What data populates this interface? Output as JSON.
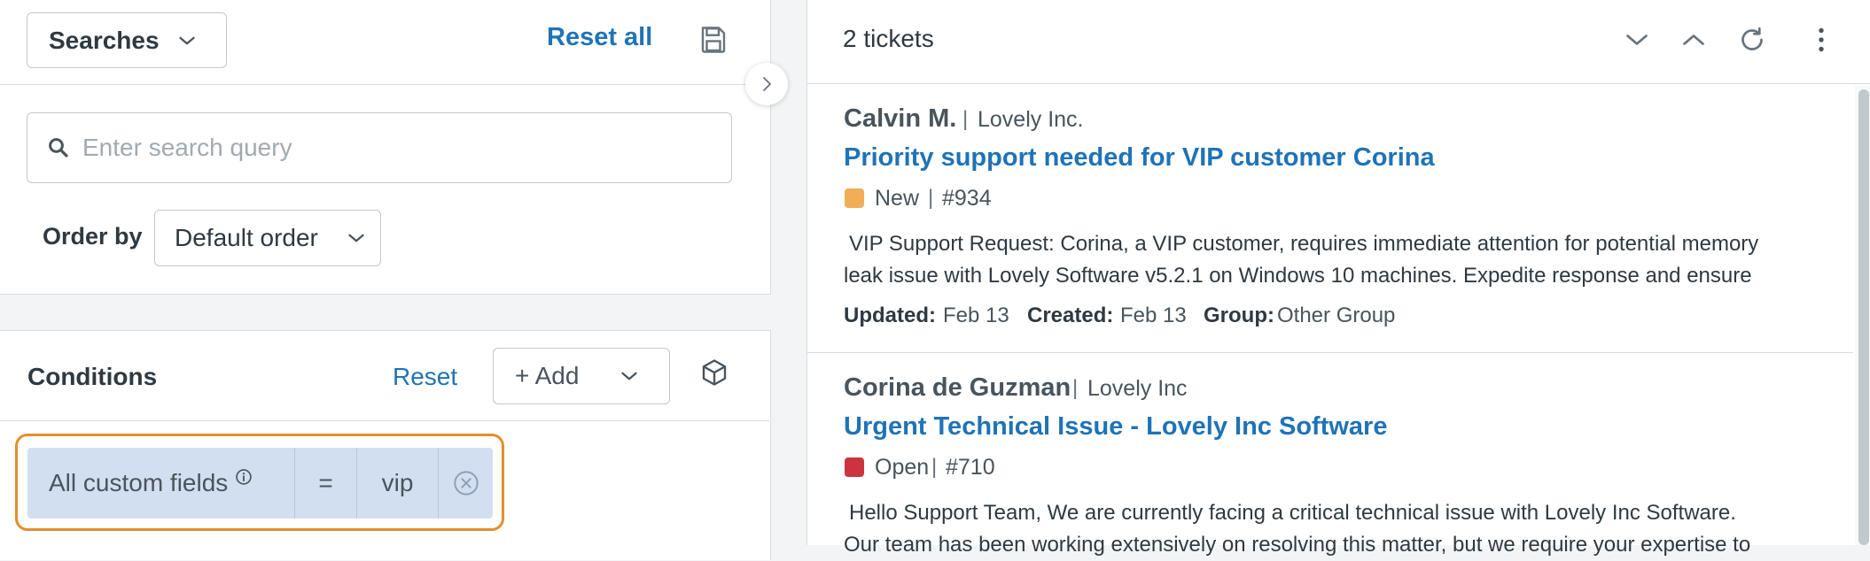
{
  "left": {
    "searches_label": "Searches",
    "reset_all_label": "Reset all",
    "search": {
      "placeholder": "Enter search query",
      "value": ""
    },
    "order_by_label": "Order by",
    "order_by_value": "Default order",
    "conditions": {
      "title": "Conditions",
      "reset_label": "Reset",
      "add_label": "+ Add",
      "chip": {
        "field": "All custom fields",
        "operator": "=",
        "value": "vip"
      }
    }
  },
  "right": {
    "count_label": "2 tickets",
    "tickets": [
      {
        "requester": "Calvin M.",
        "separator": "|",
        "organization": "Lovely Inc.",
        "subject": "Priority support needed for VIP customer Corina",
        "status": "New",
        "status_color": "#f0ae57",
        "id": "#934",
        "description_lines": [
          "VIP Support Request: Corina, a VIP customer, requires immediate attention for potential memory",
          "leak issue with Lovely Software v5.2.1 on Windows 10 machines. Expedite response and ensure"
        ],
        "meta": {
          "updated_label": "Updated:",
          "updated": "Feb 13",
          "created_label": "Created:",
          "created": "Feb 13",
          "group_label": "Group:",
          "group": "Other Group"
        }
      },
      {
        "requester": "Corina de Guzman",
        "separator": "|",
        "organization": "Lovely Inc",
        "subject": "Urgent Technical Issue - Lovely Inc Software",
        "status": "Open",
        "status_color": "#cc3340",
        "id": "#710",
        "description_lines": [
          "Hello Support Team, We are currently facing a critical technical issue with Lovely Inc Software.",
          "Our team has been working extensively on resolving this matter, but we require your expertise to"
        ]
      }
    ]
  },
  "icons": {
    "searches_chevron": "chevron-down-icon",
    "save": "save-icon",
    "search": "search-icon",
    "order_chevron": "chevron-down-icon",
    "add_chevron": "chevron-down-icon",
    "cube": "cube-icon",
    "info": "info-icon",
    "clear": "close-circle-icon",
    "expand": "chevron-right-icon",
    "next": "chevron-down-icon",
    "prev": "chevron-up-icon",
    "refresh": "refresh-icon",
    "more": "more-vertical-icon"
  },
  "colors": {
    "link": "#1f73b7",
    "chip_bg": "#d2dff0",
    "highlight_border": "#e38f2c",
    "text": "#2f3941"
  }
}
